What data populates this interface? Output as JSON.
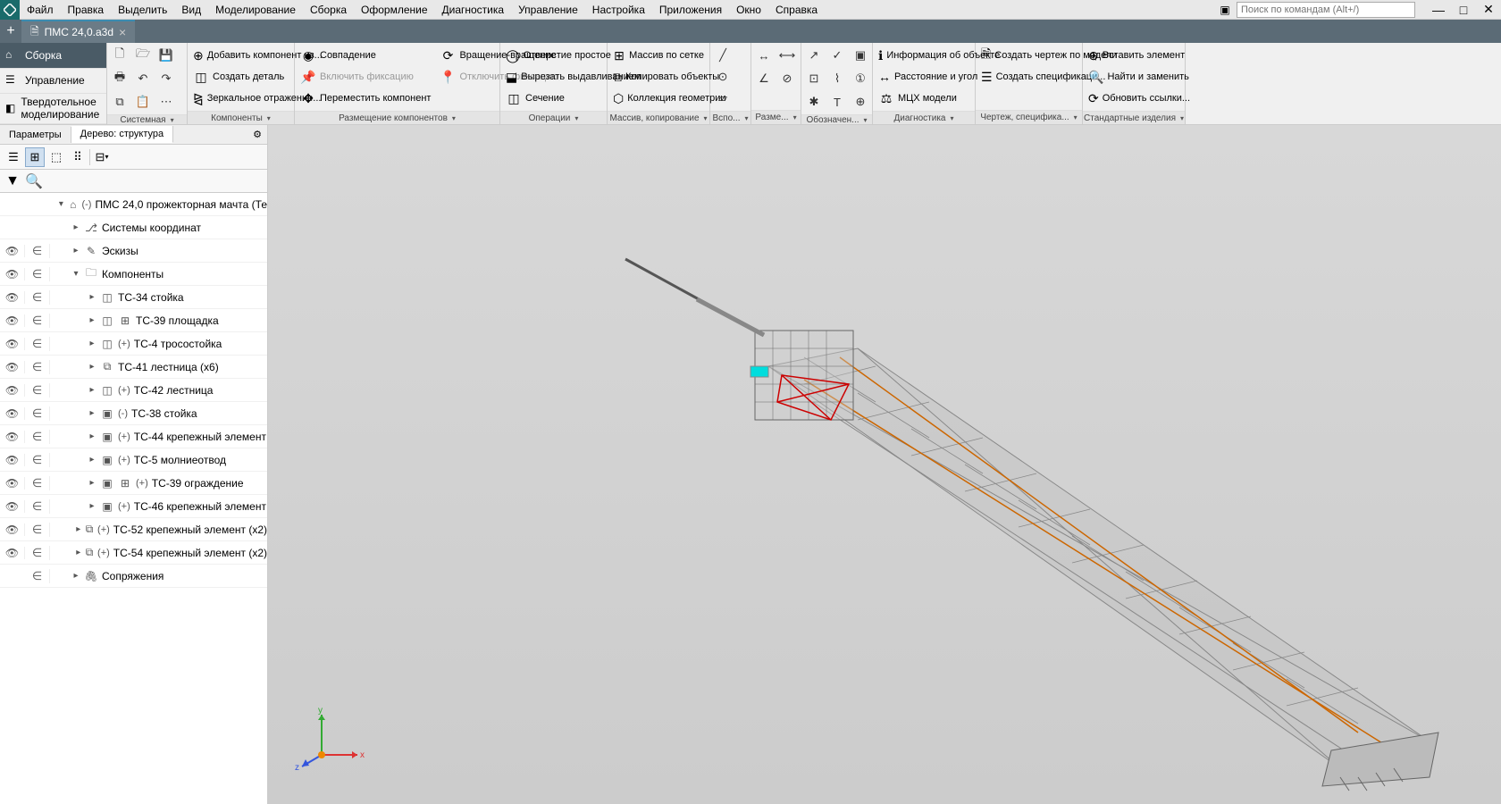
{
  "app": {
    "search_placeholder": "Поиск по командам (Alt+/)"
  },
  "menu": [
    "Файл",
    "Правка",
    "Выделить",
    "Вид",
    "Моделирование",
    "Сборка",
    "Оформление",
    "Диагностика",
    "Управление",
    "Настройка",
    "Приложения",
    "Окно",
    "Справка"
  ],
  "doc_tab": {
    "title": "ПМС 24,0.a3d"
  },
  "modes": {
    "active": "Сборка",
    "items": [
      "Сборка",
      "Управление",
      "Твердотельное моделирование"
    ]
  },
  "ribbon": {
    "sys": {
      "label": "Системная"
    },
    "comp": {
      "label": "Компоненты",
      "add_component": "Добавить компонент из...",
      "create_part": "Создать деталь",
      "mirror": "Зеркальное отражение..."
    },
    "placement": {
      "label": "Размещение компонентов",
      "sovp": "Совпадение",
      "vrash": "Вращение-вращение",
      "fix_on": "Включить фиксацию",
      "fix_off": "Отключить фиксацию",
      "move": "Переместить компонент"
    },
    "ops": {
      "label": "Операции",
      "hole": "Отверстие простое",
      "cut_extr": "Вырезать выдавливанием",
      "section": "Сечение"
    },
    "array": {
      "label": "Массив, копирование",
      "grid": "Массив по сетке",
      "copy_obj": "Копировать объекты",
      "collection": "Коллекция геометрии"
    },
    "vsp": {
      "label": "Вспо..."
    },
    "dims": {
      "label": "Разме..."
    },
    "annot": {
      "label": "Обозначен..."
    },
    "diag": {
      "label": "Диагностика",
      "info": "Информация об объекте",
      "dist": "Расстояние и угол",
      "mcx": "МЦХ модели"
    },
    "draw": {
      "label": "Чертеж, специфика...",
      "create_draw": "Создать чертеж по модели",
      "create_spec": "Создать спецификаци..."
    },
    "std": {
      "label": "Стандартные изделия",
      "insert": "Вставить элемент",
      "find": "Найти и заменить",
      "refresh": "Обновить ссылки..."
    }
  },
  "panel": {
    "tab_params": "Параметры",
    "tab_tree": "Дерево: структура"
  },
  "tree": {
    "root": "ПМС 24,0 прожекторная мачта (Те",
    "nodes": [
      {
        "label": "Системы координат",
        "indent": 1,
        "eye": "",
        "in": "",
        "exp": "▸",
        "icon": "⎇"
      },
      {
        "label": "Эскизы",
        "indent": 1,
        "eye": "👁",
        "in": "∈",
        "exp": "▸",
        "icon": "✎"
      },
      {
        "label": "Компоненты",
        "indent": 1,
        "eye": "👁",
        "in": "∈",
        "exp": "▾",
        "icon": "🗀"
      },
      {
        "label": "ТС-34 стойка",
        "indent": 2,
        "eye": "👁",
        "in": "∈",
        "exp": "▸",
        "icon": "◫"
      },
      {
        "label": "ТС-39 площадка",
        "indent": 2,
        "eye": "👁",
        "in": "∈",
        "exp": "▸",
        "icon": "◫",
        "extra": "⊞"
      },
      {
        "label": "ТС-4 тросостойка",
        "indent": 2,
        "eye": "👁",
        "in": "∈",
        "exp": "▸",
        "icon": "◫",
        "plus": "(+)"
      },
      {
        "label": "ТС-41 лестница (x6)",
        "indent": 2,
        "eye": "👁",
        "in": "∈",
        "exp": "▸",
        "icon": "⧉"
      },
      {
        "label": "ТС-42 лестница",
        "indent": 2,
        "eye": "👁",
        "in": "∈",
        "exp": "▸",
        "icon": "◫",
        "plus": "(+)"
      },
      {
        "label": "ТС-38 стойка",
        "indent": 2,
        "eye": "👁",
        "in": "∈",
        "exp": "▸",
        "icon": "▣",
        "plus": "(-)"
      },
      {
        "label": "ТС-44 крепежный элемент",
        "indent": 2,
        "eye": "👁",
        "in": "∈",
        "exp": "▸",
        "icon": "▣",
        "plus": "(+)"
      },
      {
        "label": "ТС-5 молниеотвод",
        "indent": 2,
        "eye": "👁",
        "in": "∈",
        "exp": "▸",
        "icon": "▣",
        "plus": "(+)"
      },
      {
        "label": "ТС-39 ограждение",
        "indent": 2,
        "eye": "👁",
        "in": "∈",
        "exp": "▸",
        "icon": "▣",
        "extra": "⊞",
        "plus": "(+)"
      },
      {
        "label": "ТС-46 крепежный элемент",
        "indent": 2,
        "eye": "👁",
        "in": "∈",
        "exp": "▸",
        "icon": "▣",
        "plus": "(+)"
      },
      {
        "label": "ТС-52 крепежный элемент (x2)",
        "indent": 2,
        "eye": "👁",
        "in": "∈",
        "exp": "▸",
        "icon": "⧉",
        "plus": "(+)"
      },
      {
        "label": "ТС-54 крепежный элемент (x2)",
        "indent": 2,
        "eye": "👁",
        "in": "∈",
        "exp": "▸",
        "icon": "⧉",
        "plus": "(+)"
      },
      {
        "label": "Сопряжения",
        "indent": 1,
        "eye": "",
        "in": "∈",
        "exp": "▸",
        "icon": "🖇"
      }
    ]
  },
  "gizmo": {
    "x": "x",
    "y": "y",
    "z": "z"
  }
}
